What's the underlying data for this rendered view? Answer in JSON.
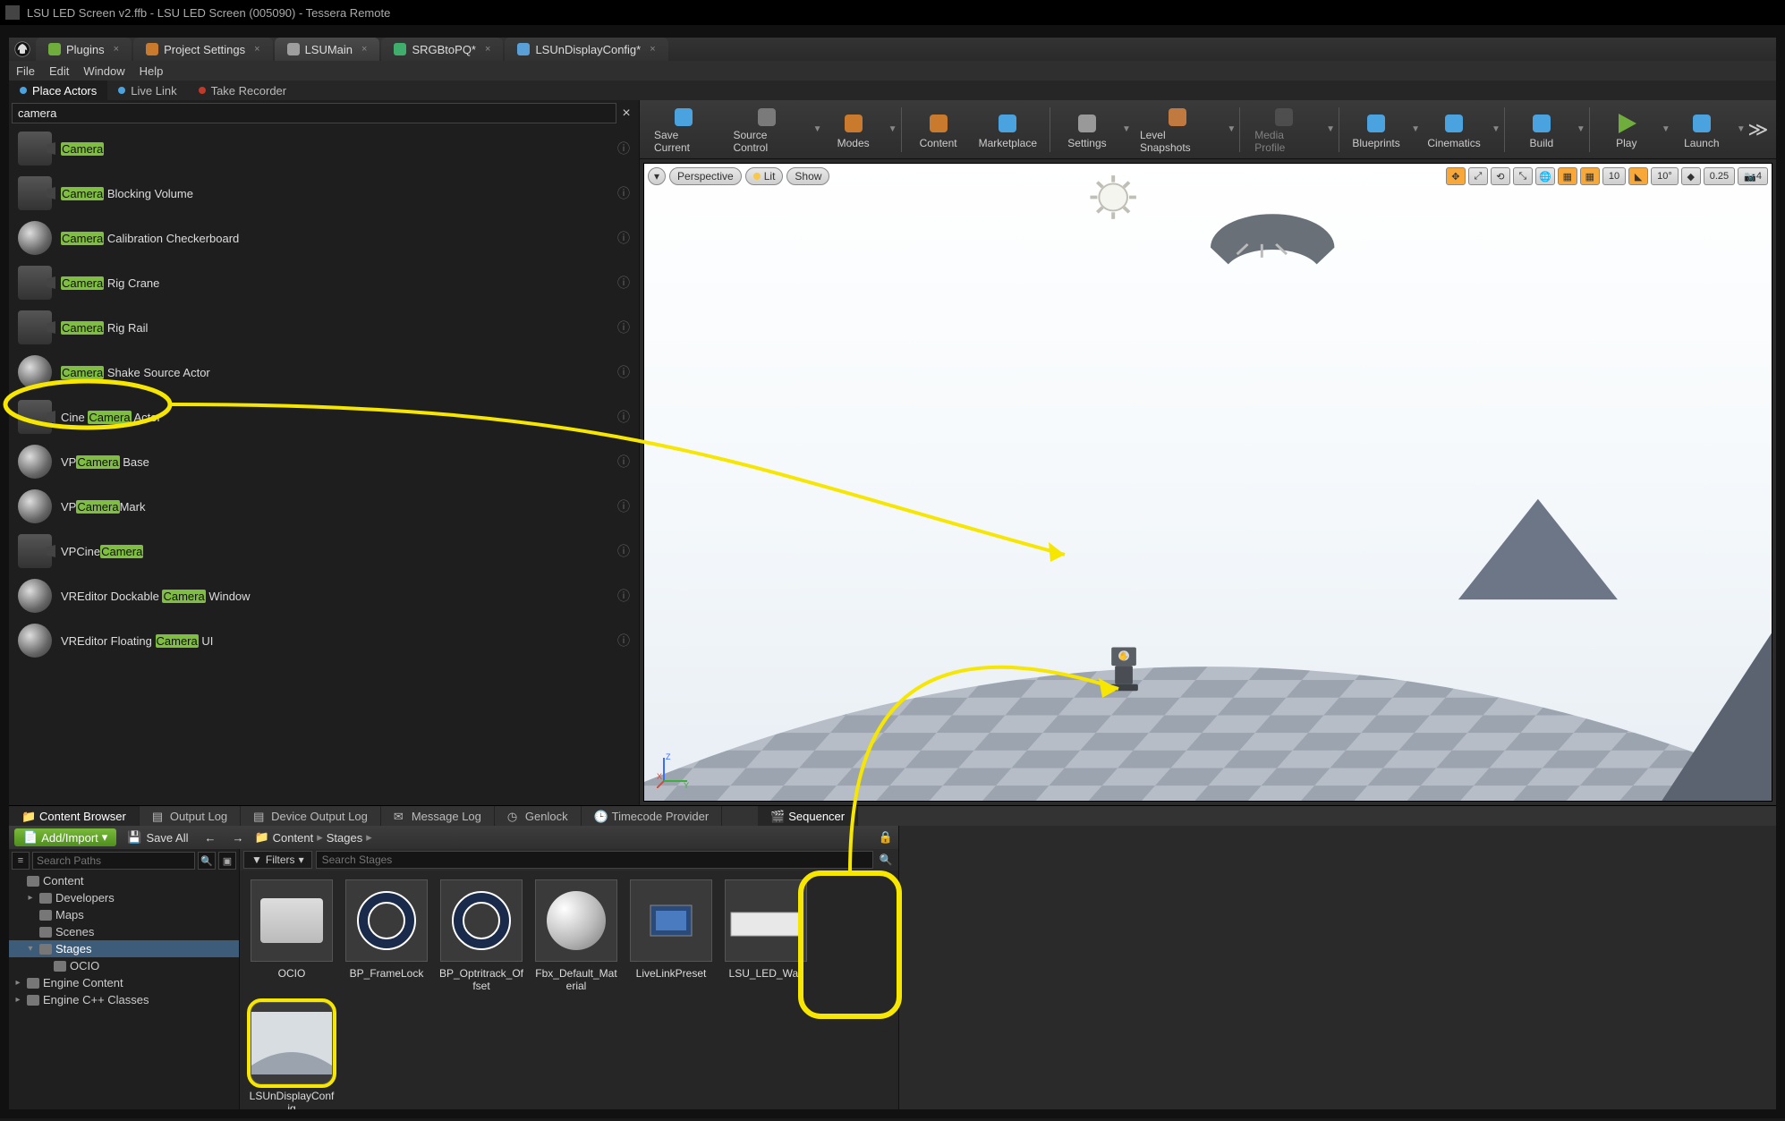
{
  "window": {
    "title": "LSU LED Screen v2.ffb - LSU LED Screen (005090) - Tessera Remote"
  },
  "top_tabs": [
    {
      "label": "Plugins",
      "icon": "plugin-icon",
      "color": "#6fae3c"
    },
    {
      "label": "Project Settings",
      "icon": "gear-icon",
      "color": "#c97a2c"
    },
    {
      "label": "LSUMain",
      "icon": "level-icon",
      "color": "#9e9e9e",
      "active": true
    },
    {
      "label": "SRGBtoPQ*",
      "icon": "material-icon",
      "color": "#3fae6d"
    },
    {
      "label": "LSUnDisplayConfig*",
      "icon": "config-icon",
      "color": "#5aa0d8"
    }
  ],
  "menu": {
    "file": "File",
    "edit": "Edit",
    "window": "Window",
    "help": "Help"
  },
  "subtabs": {
    "place_actors": "Place Actors",
    "live_link": "Live Link",
    "take_recorder": "Take Recorder"
  },
  "search": {
    "value": "camera"
  },
  "highlight_token": "Camera",
  "actor_results": [
    {
      "pre": "",
      "post": "",
      "thumb": "cam"
    },
    {
      "pre": "",
      "post": " Blocking Volume",
      "thumb": "cam"
    },
    {
      "pre": "",
      "post": " Calibration Checkerboard",
      "thumb": "sphere"
    },
    {
      "pre": "",
      "post": " Rig Crane",
      "thumb": "cam"
    },
    {
      "pre": "",
      "post": " Rig Rail",
      "thumb": "cam"
    },
    {
      "pre": "",
      "post": " Shake Source Actor",
      "thumb": "sphere"
    },
    {
      "pre": "Cine ",
      "post": " Actor",
      "thumb": "cam",
      "annot": true
    },
    {
      "pre": "VP",
      "post": " Base",
      "thumb": "sphere"
    },
    {
      "pre": "VP",
      "post": "Mark",
      "thumb": "sphere"
    },
    {
      "pre": "VPCine",
      "post": "",
      "thumb": "cam"
    },
    {
      "pre": "VREditor Dockable ",
      "post": " Window",
      "thumb": "sphere"
    },
    {
      "pre": "VREditor Floating ",
      "post": " UI",
      "thumb": "sphere"
    }
  ],
  "toolbar": [
    {
      "name": "save-current",
      "label": "Save Current",
      "color": "#4aa3df"
    },
    {
      "name": "source-control",
      "label": "Source Control",
      "color": "#7a7a7a",
      "drop": true
    },
    {
      "name": "modes",
      "label": "Modes",
      "color": "#c97a2c",
      "drop": true,
      "sep_after": true
    },
    {
      "name": "content",
      "label": "Content",
      "color": "#c97a2c"
    },
    {
      "name": "marketplace",
      "label": "Marketplace",
      "color": "#4aa3df",
      "sep_after": true
    },
    {
      "name": "settings",
      "label": "Settings",
      "color": "#999",
      "drop": true
    },
    {
      "name": "level-snapshots",
      "label": "Level Snapshots",
      "color": "#c07a40",
      "drop": true,
      "sep_after": true
    },
    {
      "name": "media-profile",
      "label": "Media Profile",
      "color": "#666",
      "disabled": true,
      "drop": true,
      "sep_after": true
    },
    {
      "name": "blueprints",
      "label": "Blueprints",
      "color": "#4aa3df",
      "drop": true
    },
    {
      "name": "cinematics",
      "label": "Cinematics",
      "color": "#4aa3df",
      "drop": true,
      "sep_after": true
    },
    {
      "name": "build",
      "label": "Build",
      "color": "#4aa3df",
      "drop": true,
      "sep_after": true
    },
    {
      "name": "play",
      "label": "Play",
      "color": "#6fae3c",
      "drop": true
    },
    {
      "name": "launch",
      "label": "Launch",
      "color": "#4aa3df",
      "drop": true
    }
  ],
  "viewport": {
    "menu_dd": "▾",
    "perspective": "Perspective",
    "lit": "Lit",
    "show": "Show",
    "snap_angle": "10",
    "snap_angle2": "10°",
    "snap_scale": "0.25",
    "cam_speed": "4"
  },
  "bottom_tabs": {
    "content_browser": "Content Browser",
    "output_log": "Output Log",
    "device_output_log": "Device Output Log",
    "message_log": "Message Log",
    "genlock": "Genlock",
    "timecode_provider": "Timecode Provider",
    "sequencer": "Sequencer"
  },
  "content_browser": {
    "add_import": "Add/Import",
    "save_all": "Save All",
    "path_root": "Content",
    "path_sub": "Stages",
    "search_paths_ph": "Search Paths",
    "filters": "Filters",
    "search_assets_ph": "Search Stages",
    "tree": [
      {
        "label": "Content",
        "depth": 0,
        "expanded": true
      },
      {
        "label": "Developers",
        "depth": 1,
        "expanded": false,
        "haschild": true
      },
      {
        "label": "Maps",
        "depth": 1
      },
      {
        "label": "Scenes",
        "depth": 1
      },
      {
        "label": "Stages",
        "depth": 1,
        "expanded": true,
        "selected": true,
        "haschild": true
      },
      {
        "label": "OCIO",
        "depth": 2
      },
      {
        "label": "Engine Content",
        "depth": 0,
        "haschild": true
      },
      {
        "label": "Engine C++ Classes",
        "depth": 0,
        "haschild": true
      }
    ],
    "assets": [
      {
        "name": "OCIO",
        "kind": "folder"
      },
      {
        "name": "BP_FrameLock",
        "kind": "ring"
      },
      {
        "name": "BP_Optritrack_Offset",
        "kind": "ring"
      },
      {
        "name": "Fbx_Default_Material",
        "kind": "sphere"
      },
      {
        "name": "LiveLinkPreset",
        "kind": "preset"
      },
      {
        "name": "LSU_LED_Wall",
        "kind": "wall"
      },
      {
        "name": "LSUnDisplayConfig",
        "kind": "stage",
        "highlight": true
      }
    ]
  },
  "annotation": {
    "color": "#f7e600"
  }
}
